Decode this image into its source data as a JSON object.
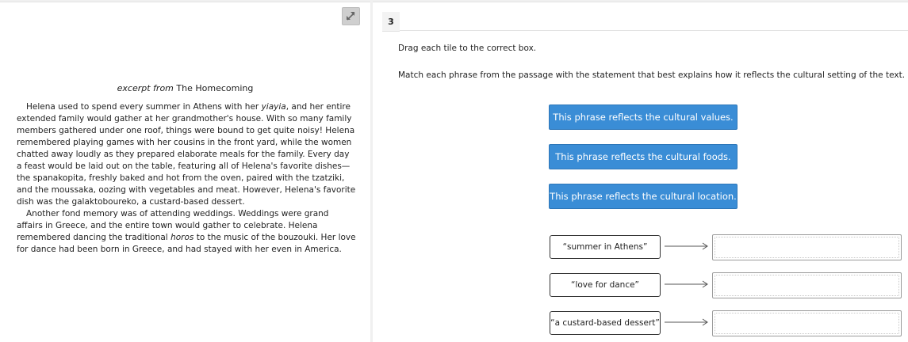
{
  "question": {
    "number": "3",
    "instruction": "Drag each tile to the correct box.",
    "prompt": "Match each phrase from the passage with the statement that best explains how it reflects the cultural setting of the text."
  },
  "passage": {
    "title_prefix": "excerpt from",
    "title": "The Homecoming",
    "paragraphs": [
      [
        {
          "t": "Helena used to spend every summer in Athens with her "
        },
        {
          "t": "yiayia",
          "i": true
        },
        {
          "t": ", and her entire extended family would gather at her grandmother's house. With so many family members gathered under one roof, things were bound to get quite noisy! Helena remembered playing games with her cousins in the front yard, while the women chatted away loudly as they prepared elaborate meals for the family. Every day a feast would be laid out on the table, featuring all of Helena's favorite dishes—the spanakopita, freshly baked and hot from the oven, paired with the tzatziki, and the moussaka, oozing with vegetables and meat. However, Helena's favorite dish was the galaktoboureko, a custard-based dessert."
        }
      ],
      [
        {
          "t": "Another fond memory was of attending weddings. Weddings were grand affairs in Greece, and the entire town would gather to celebrate. Helena remembered dancing the traditional "
        },
        {
          "t": "horos",
          "i": true
        },
        {
          "t": " to the music of the bouzouki. Her love for dance had been born in Greece, and had stayed with her even in America."
        }
      ]
    ]
  },
  "tiles": [
    "This phrase reflects the cultural values.",
    "This phrase reflects the cultural foods.",
    "This phrase reflects the cultural location."
  ],
  "phrases": [
    "“summer in Athens”",
    "“love for dance”",
    "“a custard-based dessert”"
  ],
  "icons": {
    "expand": "expand-arrows-icon",
    "match_arrow": "right-arrow-icon"
  },
  "colors": {
    "tile_bg": "#3a8dd6",
    "tile_text": "#ffffff"
  }
}
